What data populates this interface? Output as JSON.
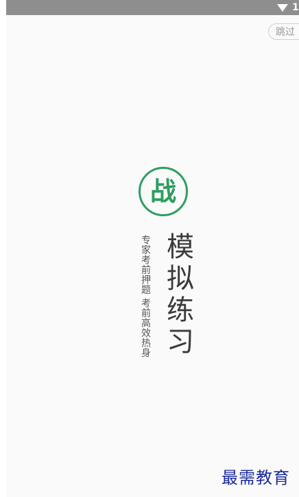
{
  "status_bar": {
    "signal_icon": "wifi-icon",
    "trailing_digit": "1"
  },
  "skip_button": {
    "label": "跳过"
  },
  "logo": {
    "char": "战",
    "color": "#2c9e5f"
  },
  "title": "模拟练习",
  "subtitle": "专家考前押题  考前高效热身",
  "watermark": "最需教育"
}
